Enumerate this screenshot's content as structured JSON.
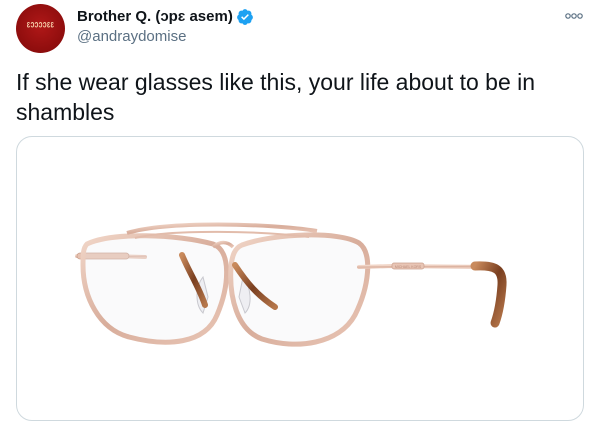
{
  "author": {
    "display_name": "Brother Q. (ɔpɛ asem)",
    "handle": "@andraydomise",
    "avatar_text": "ɛɔɔɔɔɛɛ"
  },
  "tweet": {
    "text": "If she wear glasses like this, your life about to be in shambles"
  },
  "icons": {
    "verified": "verified-badge-icon",
    "more": "more-options-icon"
  },
  "media": {
    "subject": "glasses-photo",
    "frame_text": "MICHAEL KORS"
  },
  "colors": {
    "verified_blue": "#1da1f2",
    "frame_rose_gold": "#dcb4a4",
    "tortoise_tip": "#9a5a34"
  }
}
